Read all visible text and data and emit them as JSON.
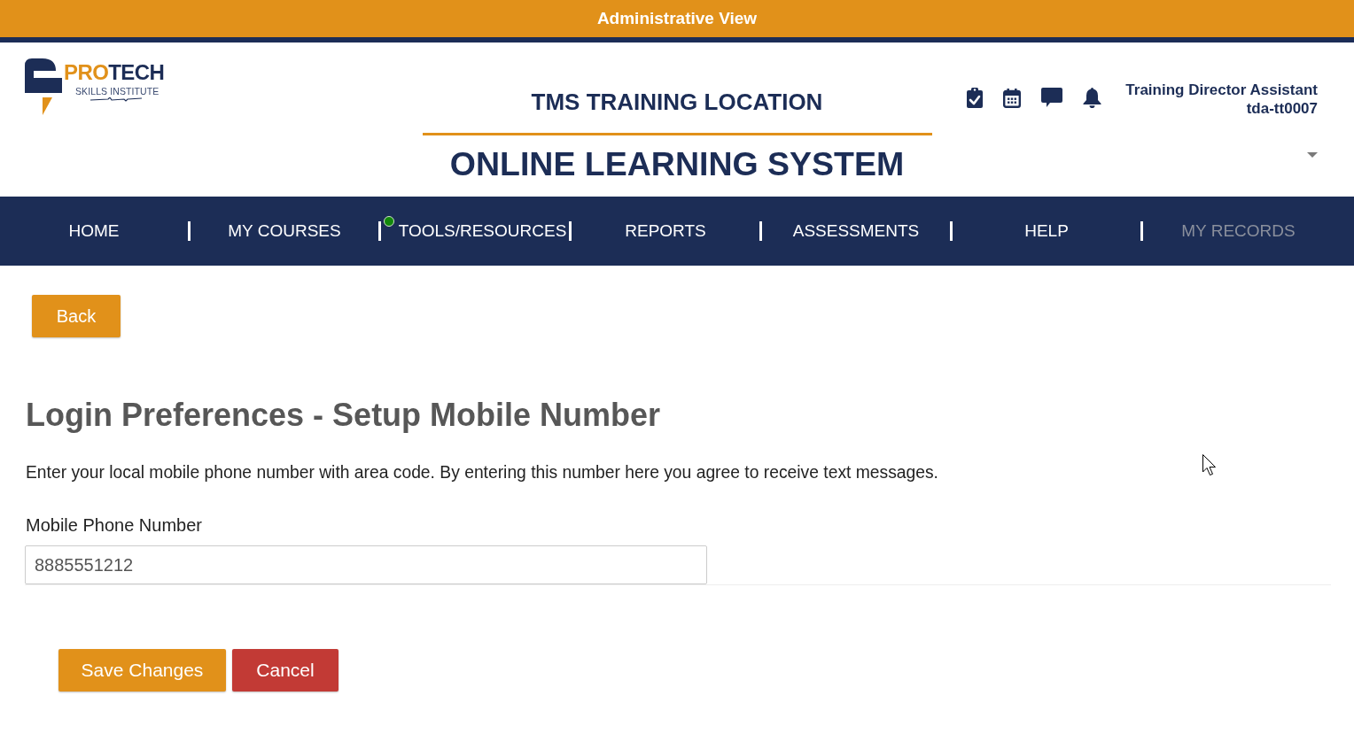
{
  "admin_banner": {
    "title": "Administrative View"
  },
  "header": {
    "logo": {
      "accent": "PRO",
      "rest": "TECH",
      "tagline": "SKILLS INSTITUTE"
    },
    "location": "TMS TRAINING LOCATION",
    "system_title": "ONLINE LEARNING SYSTEM",
    "user": {
      "role": "Training Director Assistant",
      "username": "tda-tt0007"
    }
  },
  "nav": [
    {
      "label": "HOME",
      "disabled": false,
      "dot": false
    },
    {
      "label": "MY COURSES",
      "disabled": false,
      "dot": false
    },
    {
      "label": "TOOLS/RESOURCES",
      "disabled": false,
      "dot": true
    },
    {
      "label": "REPORTS",
      "disabled": false,
      "dot": false
    },
    {
      "label": "ASSESSMENTS",
      "disabled": false,
      "dot": false
    },
    {
      "label": "HELP",
      "disabled": false,
      "dot": false
    },
    {
      "label": "MY RECORDS",
      "disabled": true,
      "dot": false
    }
  ],
  "back_button": {
    "label": "Back"
  },
  "page": {
    "title": "Login Preferences - Setup Mobile Number",
    "intro": "Enter your local mobile phone number with area code. By entering this number here you agree to receive text messages.",
    "field": {
      "label": "Mobile Phone Number",
      "value": "8885551212"
    }
  },
  "actions": [
    {
      "label": "Save Changes",
      "kind": "primary"
    },
    {
      "label": "Cancel",
      "kind": "danger"
    }
  ]
}
